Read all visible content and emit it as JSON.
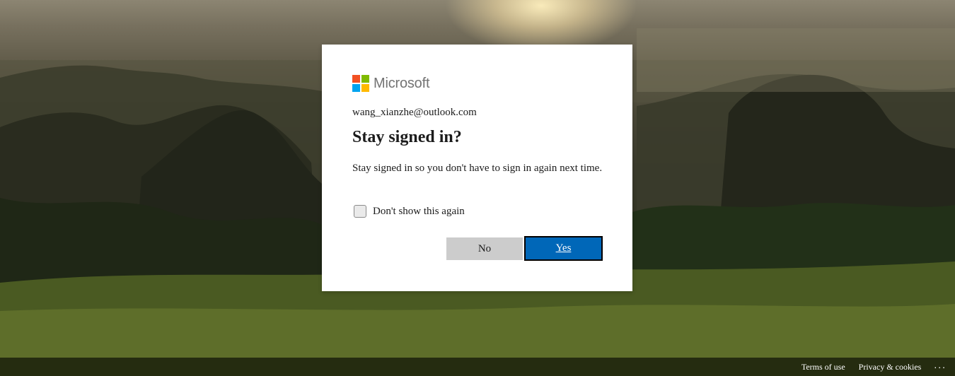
{
  "brand": {
    "name": "Microsoft",
    "logo_colors": [
      "#f25022",
      "#7fba00",
      "#00a4ef",
      "#ffb900"
    ]
  },
  "dialog": {
    "account": "wang_xianzhe@outlook.com",
    "title": "Stay signed in?",
    "description": "Stay signed in so you don't have to sign in again next time.",
    "checkbox_label": "Don't show this again",
    "checkbox_checked": false,
    "no_label": "No",
    "yes_label": "Yes",
    "accent_color": "#0067b8"
  },
  "footer": {
    "terms": "Terms of use",
    "privacy": "Privacy & cookies",
    "more": "..."
  }
}
